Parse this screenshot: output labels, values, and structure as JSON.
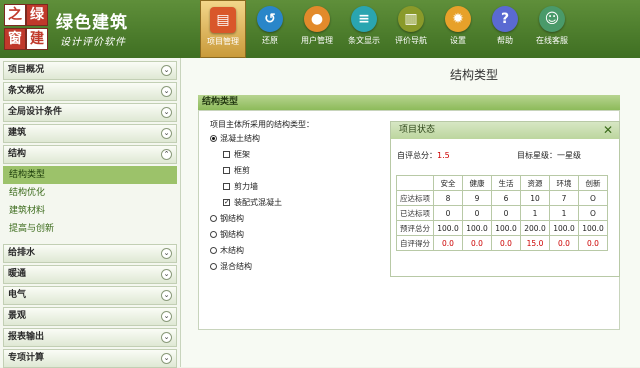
{
  "logo": {
    "chars": [
      "之",
      "绿",
      "窗",
      "建"
    ]
  },
  "app": {
    "title": "绿色建筑",
    "subtitle": "设计评价软件"
  },
  "toolbar": [
    {
      "label": "项目管理",
      "icon": "project-icon",
      "color": "#d9572a"
    },
    {
      "label": "还原",
      "icon": "restore-icon",
      "color": "#2a86c9"
    },
    {
      "label": "用户管理",
      "icon": "user-icon",
      "color": "#e28a2b"
    },
    {
      "label": "条文显示",
      "icon": "document-icon",
      "color": "#2aa5b0"
    },
    {
      "label": "评价导航",
      "icon": "guide-book-icon",
      "color": "#8a9a2a"
    },
    {
      "label": "设置",
      "icon": "gear-icon",
      "color": "#e7a12a"
    },
    {
      "label": "帮助",
      "icon": "help-icon",
      "color": "#5a6ad2"
    },
    {
      "label": "在线客服",
      "icon": "support-icon",
      "color": "#4a9a6a"
    }
  ],
  "sidebar": {
    "groups_top": [
      "项目概况",
      "条文概况",
      "全局设计条件",
      "建筑",
      "结构"
    ],
    "sub_items": [
      "结构类型",
      "结构优化",
      "建筑材料",
      "提高与创新"
    ],
    "selected": "结构类型",
    "groups_bottom": [
      "给排水",
      "暖通",
      "电气",
      "景观",
      "报表输出",
      "专项计算"
    ]
  },
  "main": {
    "page_title": "结构类型",
    "section_title": "结构类型",
    "question": "项目主体所采用的结构类型：",
    "options": [
      {
        "label": "混凝土结构",
        "selected": true
      },
      {
        "label": "钢结构",
        "selected": false
      },
      {
        "label": "钢结构",
        "selected": false
      },
      {
        "label": "木结构",
        "selected": false
      },
      {
        "label": "混合结构",
        "selected": false
      }
    ],
    "sub_options": [
      {
        "label": "框架",
        "checked": false
      },
      {
        "label": "框剪",
        "checked": false
      },
      {
        "label": "剪力墙",
        "checked": false
      },
      {
        "label": "装配式混凝土",
        "checked": true
      }
    ]
  },
  "status_panel": {
    "title": "项目状态",
    "close": "✕",
    "self_score_label": "自评总分：",
    "self_score_value": "1.5",
    "target_label": "目标星级：",
    "target_value": "一星级",
    "columns": [
      "安全",
      "健康",
      "生活",
      "资源",
      "环境",
      "创新"
    ],
    "rows": [
      {
        "label": "应达标项",
        "values": [
          "8",
          "9",
          "6",
          "10",
          "7",
          "O"
        ],
        "red": false
      },
      {
        "label": "已达标项",
        "values": [
          "0",
          "0",
          "0",
          "1",
          "1",
          "O"
        ],
        "red": false
      },
      {
        "label": "预评总分",
        "values": [
          "100.0",
          "100.0",
          "100.0",
          "200.0",
          "100.0",
          "100.0"
        ],
        "red": false
      },
      {
        "label": "自评得分",
        "values": [
          "0.0",
          "0.0",
          "0.0",
          "15.0",
          "0.0",
          "0.0"
        ],
        "red": true
      }
    ]
  }
}
